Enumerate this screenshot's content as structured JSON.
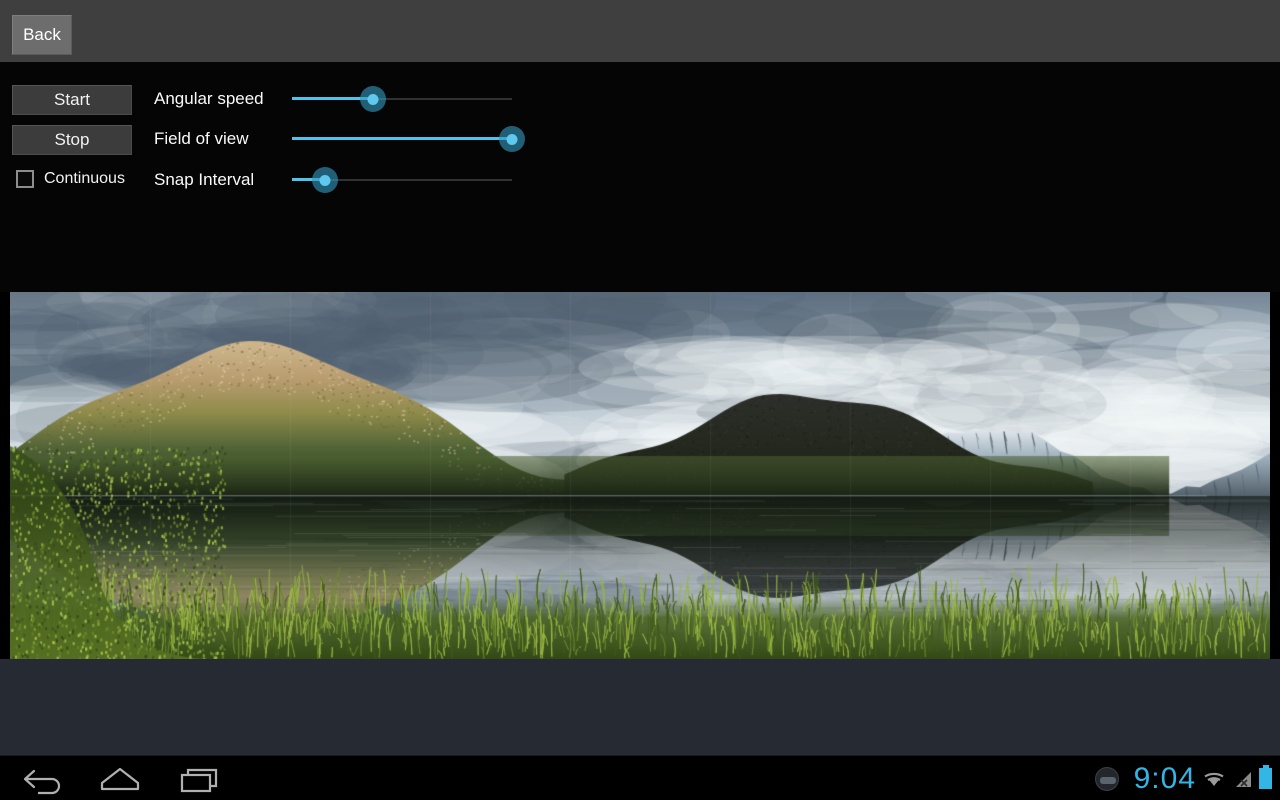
{
  "app": {
    "background_color": "#000000",
    "topbar_color": "#3f3f3f",
    "accent_color": "#33b5e5",
    "slider_color": "#4fc3e8"
  },
  "topbar": {
    "back_label": "Back"
  },
  "controls": {
    "start_label": "Start",
    "stop_label": "Stop",
    "continuous_label": "Continuous",
    "continuous_checked": false,
    "sliders": [
      {
        "label": "Angular speed",
        "value": 37,
        "min": 0,
        "max": 100
      },
      {
        "label": "Field of view",
        "value": 100,
        "min": 0,
        "max": 100
      },
      {
        "label": "Snap Interval",
        "value": 15,
        "min": 0,
        "max": 100
      }
    ]
  },
  "preview": {
    "name": "panorama-preview",
    "description": "Panoramic landscape photo: sunlit mountain ridge and dark hill reflected in a still lake, green grass in the foreground, snow-capped peaks on the right, cloudy sky above"
  },
  "navbar": {
    "back_icon": "back-arrow-icon",
    "home_icon": "home-icon",
    "recent_icon": "recent-apps-icon"
  },
  "status": {
    "notification_icon": "notification-badge-icon",
    "time": "9:04",
    "wifi_icon": "wifi-icon",
    "signal_icon": "cellular-no-signal-icon",
    "battery_icon": "battery-full-icon"
  }
}
